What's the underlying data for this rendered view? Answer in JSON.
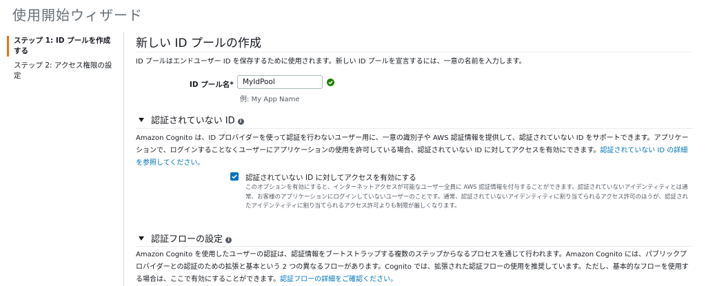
{
  "wizard_title": "使用開始ウィザード",
  "sidebar": {
    "items": [
      {
        "label": "ステップ 1: ID プールを作成する",
        "active": true
      },
      {
        "label": "ステップ 2: アクセス権限の設定",
        "active": false
      }
    ]
  },
  "main": {
    "title": "新しい ID プールの作成",
    "intro": "ID プールはエンドユーザー ID を保存するために使用されます。新しい ID プールを宣言するには、一意の名前を入力します。",
    "pool_name": {
      "label": "ID プール名*",
      "value": "MyIdPool",
      "example": "例: My App Name"
    },
    "unauth": {
      "heading": "認証されていない ID",
      "description": "Amazon Cognito は、ID プロバイダーを使って認証を行わないユーザー用に、一意の識別子や AWS 認証情報を提供して、認証されていない ID をサポートできます。アプリケーションで、ログインすることなくユーザーにアプリケーションの使用を許可している場合、認証されていない ID に対してアクセスを有効にできます。",
      "link": "認証されていない ID の詳細を参照してください。",
      "checkbox_label": "認証されていない ID に対してアクセスを有効にする",
      "checkbox_checked": true,
      "checkbox_desc": "このオプションを有効にすると、インターネットアクセスが可能なユーザー全員に AWS 認証情報を付与することができます。認証されていないアイデンティティとは通常、お客様のアプリケーションにログインしていないユーザーのことです。通常、認証されていないアイデンティティに割り当てられるアクセス許可のほうが、認証されたアイデンティティに割り当てられるアクセス許可よりも制限が厳しくなります。"
    },
    "auth_flow": {
      "heading": "認証フローの設定",
      "description": "Amazon Cognito を使用したユーザーの認証は、認証情報をブートストラップする複数のステップからなるプロセスを通じて行われます。Amazon Cognito には、パブリックプロバイダーとの認証のための拡張と基本という 2 つの異なるフローがあります。Cognito では、拡張された認証フローの使用を推奨しています。ただし、基本的なフローを使用する場合は、ここで有効にすることができます。",
      "link": "認証フローの詳細をご確認ください。"
    }
  },
  "colors": {
    "accent": "#ec7211",
    "link": "#0073bb",
    "success": "#1d8102"
  }
}
